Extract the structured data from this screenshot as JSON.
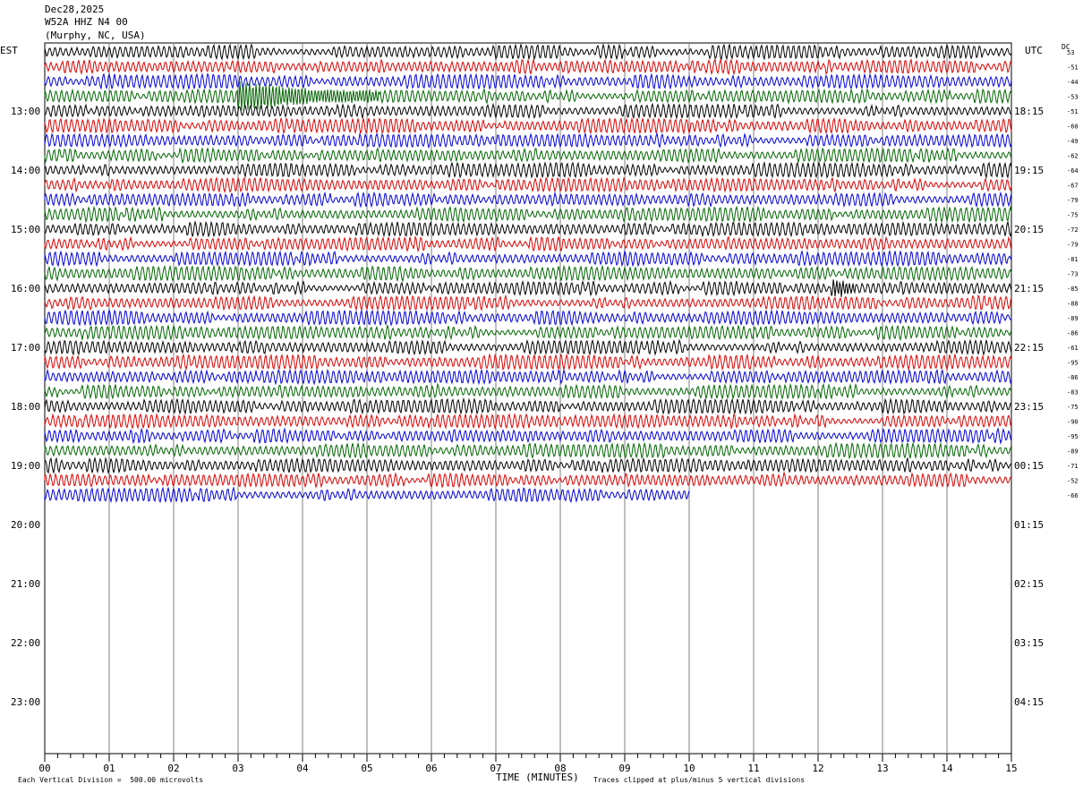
{
  "header": {
    "date": "Dec28,2025",
    "station": "W52A HHZ N4 00",
    "location": "(Murphy, NC, USA)"
  },
  "axes": {
    "left_zone": "EST",
    "right_zone": "UTC",
    "dc_label": "DC",
    "x_label": "TIME (MINUTES)",
    "x_ticks": [
      "00",
      "01",
      "02",
      "03",
      "04",
      "05",
      "06",
      "07",
      "08",
      "09",
      "10",
      "11",
      "12",
      "13",
      "14",
      "15"
    ]
  },
  "footer": {
    "division_note": "Each Vertical Division =  500.00 microvolts",
    "clip_note": "Traces clipped at plus/minus 5 vertical divisions"
  },
  "colors": {
    "trace_cycle": [
      "#000000",
      "#dd0000",
      "#0000dd",
      "#006600"
    ],
    "grid": "#808080"
  },
  "chart_data": {
    "type": "line",
    "title": "Dec28,2025 W52A HHZ N4 00 (Murphy, NC, USA)",
    "xlabel": "TIME (MINUTES)",
    "xlim": [
      0,
      15
    ],
    "minutes_per_line": 15,
    "lines_per_hour": 4,
    "hour_labels_est": [
      "13:00",
      "14:00",
      "15:00",
      "16:00",
      "17:00",
      "18:00",
      "19:00",
      "20:00",
      "21:00",
      "22:00",
      "23:00"
    ],
    "hour_labels_utc": [
      "18:15",
      "19:15",
      "20:15",
      "21:15",
      "22:15",
      "23:15",
      "00:15",
      "01:15",
      "02:15",
      "03:15",
      "04:15"
    ],
    "trace_count": 31,
    "last_trace_end_minute": 10,
    "dc_offsets": [
      "53",
      "-51",
      "-44",
      "-53",
      "-51",
      "-60",
      "-49",
      "-62",
      "-64",
      "-67",
      "-79",
      "-75",
      "-72",
      "-79",
      "-81",
      "-73",
      "-85",
      "-88",
      "-89",
      "-86",
      "-61",
      "-95",
      "-86",
      "-83",
      "-75",
      "-90",
      "-95",
      "-89",
      "-71",
      "-52",
      "-66"
    ],
    "events": [
      {
        "trace": 3,
        "start_minute": 3.0,
        "end_minute": 5.2,
        "description": "large burst"
      },
      {
        "trace": 16,
        "start_minute": 12.2,
        "end_minute": 12.6,
        "description": "spike"
      }
    ]
  }
}
